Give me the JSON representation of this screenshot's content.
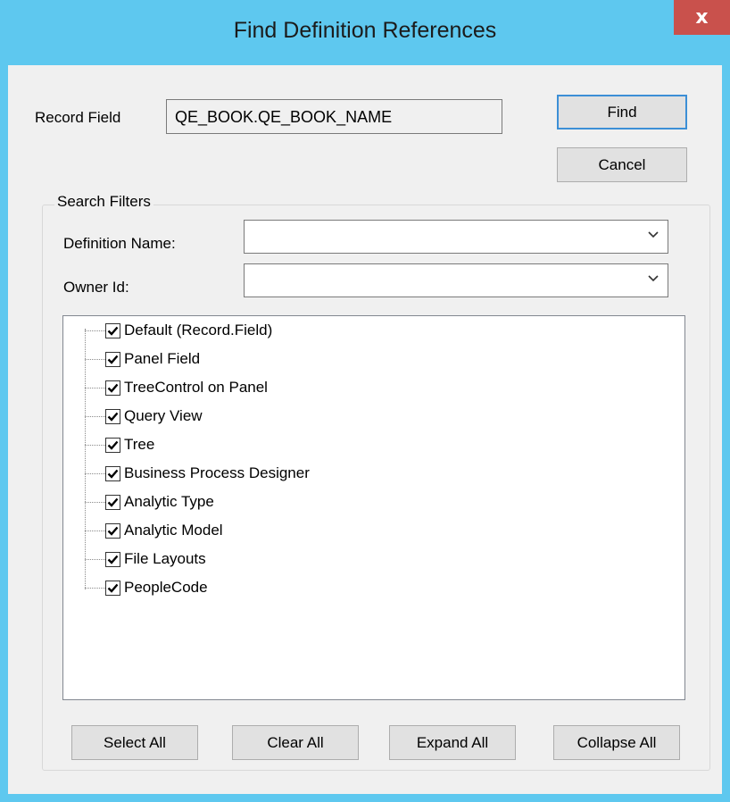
{
  "window": {
    "title": "Find Definition References",
    "close_label": "x"
  },
  "record_field": {
    "label": "Record Field",
    "value": "QE_BOOK.QE_BOOK_NAME"
  },
  "buttons": {
    "find": "Find",
    "cancel": "Cancel"
  },
  "search_filters": {
    "title": "Search Filters",
    "definition_name_label": "Definition Name:",
    "definition_name_value": "",
    "owner_id_label": "Owner Id:",
    "owner_id_value": ""
  },
  "tree_items": [
    {
      "label": "Default (Record.Field)",
      "checked": true
    },
    {
      "label": "Panel Field",
      "checked": true
    },
    {
      "label": "TreeControl on Panel",
      "checked": true
    },
    {
      "label": "Query View",
      "checked": true
    },
    {
      "label": "Tree",
      "checked": true
    },
    {
      "label": "Business Process Designer",
      "checked": true
    },
    {
      "label": "Analytic Type",
      "checked": true
    },
    {
      "label": "Analytic Model",
      "checked": true
    },
    {
      "label": "File Layouts",
      "checked": true
    },
    {
      "label": "PeopleCode",
      "checked": true
    }
  ],
  "bottom_buttons": {
    "select_all": "Select All",
    "clear_all": "Clear All",
    "expand_all": "Expand All",
    "collapse_all": "Collapse All"
  },
  "colors": {
    "title_bar": "#5ec8ef",
    "close_button": "#c9514c",
    "default_button_border": "#3c8fd6"
  }
}
